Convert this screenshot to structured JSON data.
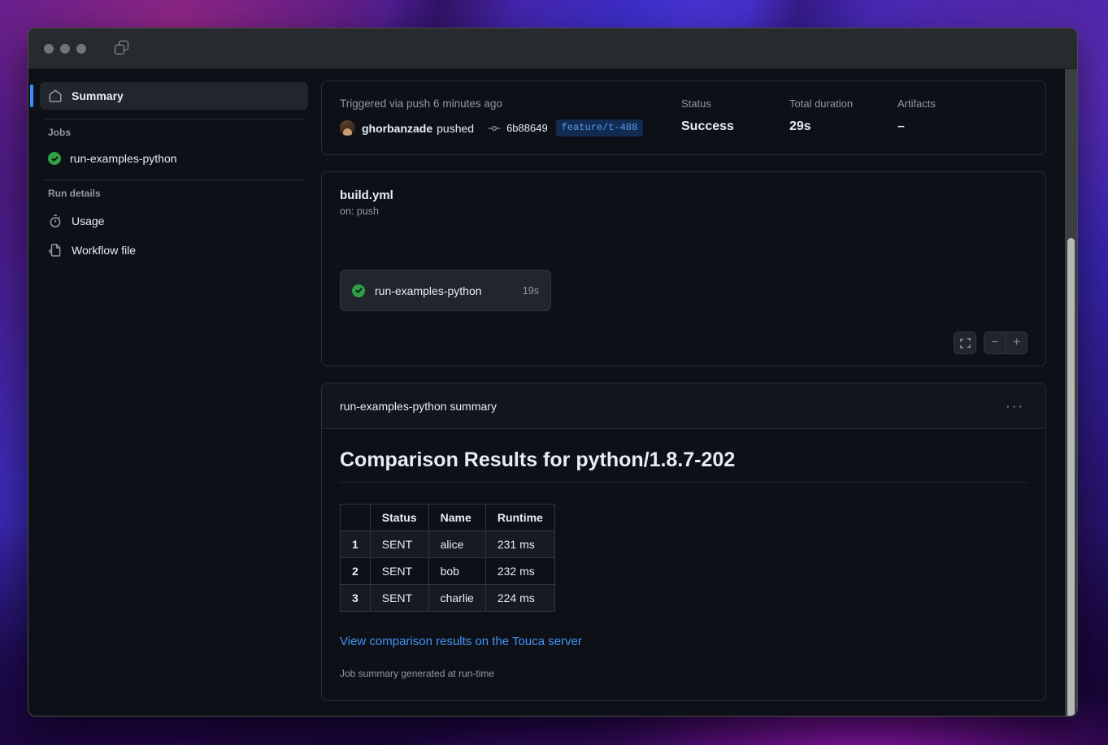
{
  "window": {
    "traffic_lights": [
      "close",
      "minimize",
      "zoom"
    ],
    "tab_icon": "tabs-icon"
  },
  "sidebar": {
    "summary": {
      "label": "Summary",
      "icon": "home-icon"
    },
    "jobs_heading": "Jobs",
    "jobs": [
      {
        "label": "run-examples-python",
        "status": "success",
        "icon": "check-circle-icon"
      }
    ],
    "run_details_heading": "Run details",
    "run_details": [
      {
        "label": "Usage",
        "icon": "stopwatch-icon"
      },
      {
        "label": "Workflow file",
        "icon": "file-code-icon"
      }
    ]
  },
  "header_card": {
    "trigger": "Triggered via push 6 minutes ago",
    "actor": "ghorbanzade",
    "action": "pushed",
    "commit_icon": "git-commit-icon",
    "commit_sha": "6b88649",
    "branch": "feature/t-488",
    "meta": [
      {
        "key": "Status",
        "value": "Success"
      },
      {
        "key": "Total duration",
        "value": "29s"
      },
      {
        "key": "Artifacts",
        "value": "–"
      }
    ]
  },
  "graph_card": {
    "workflow_file": "build.yml",
    "trigger": "on: push",
    "node": {
      "label": "run-examples-python",
      "duration": "19s",
      "status": "success"
    },
    "controls": {
      "fit": "fit-screen-icon",
      "zoom_out": "−",
      "zoom_in": "+"
    }
  },
  "summary_card": {
    "title": "run-examples-python summary",
    "kebab": "···",
    "heading": "Comparison Results for python/1.8.7-202",
    "table": {
      "headers": [
        "",
        "Status",
        "Name",
        "Runtime"
      ],
      "rows": [
        [
          "1",
          "SENT",
          "alice",
          "231 ms"
        ],
        [
          "2",
          "SENT",
          "bob",
          "232 ms"
        ],
        [
          "3",
          "SENT",
          "charlie",
          "224 ms"
        ]
      ]
    },
    "link": "View comparison results on the Touca server",
    "footer": "Job summary generated at run-time"
  },
  "colors": {
    "accent_blue": "#3d8bfd",
    "link_blue": "#4493f8",
    "success_green": "#2ea043",
    "branch_badge_bg": "#132b50",
    "branch_badge_fg": "#539bf5"
  }
}
